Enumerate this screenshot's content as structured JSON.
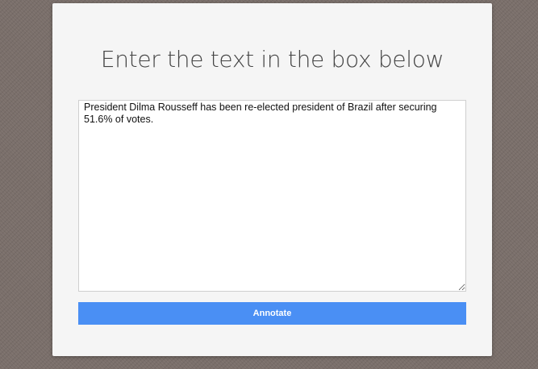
{
  "form": {
    "title": "Enter the text in the box below",
    "text_value": "President Dilma Rousseff has been re-elected president of Brazil after securing 51.6% of votes.",
    "submit_label": "Annotate"
  },
  "colors": {
    "background": "#7a6f6a",
    "card": "#f5f5f5",
    "button": "#4a8ff4",
    "button_text": "#ffffff"
  }
}
